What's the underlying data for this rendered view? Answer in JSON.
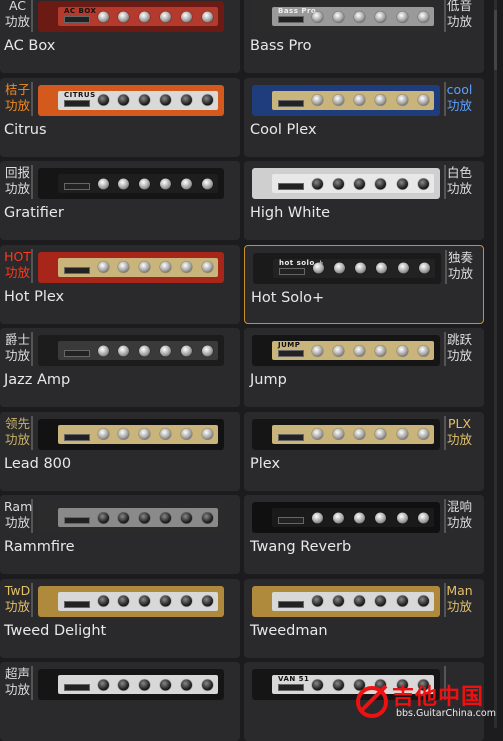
{
  "amps": [
    {
      "name": "AC Box",
      "badge": [
        "AC",
        "功放"
      ],
      "col": "left",
      "face": "#6b1a14",
      "plate": "#b33a2c",
      "knobs": "lt",
      "label": "AC BOX",
      "dark": false,
      "selected": false
    },
    {
      "name": "Bass Pro",
      "badge": [
        "低音",
        "功放"
      ],
      "col": "right",
      "face": "#2b2b2b",
      "plate": "#9a9a9a",
      "knobs": "lt",
      "label": "Bass Pro",
      "dark": false,
      "selected": false
    },
    {
      "name": "Citrus",
      "badge": [
        "桔子",
        "功放"
      ],
      "col": "left",
      "face": "#d35a1c",
      "plate": "#d9d9d9",
      "knobs": "dk",
      "label": "CITRUS",
      "dark": false,
      "selected": false,
      "badge_color": "#f08a1c"
    },
    {
      "name": "Cool Plex",
      "badge": [
        "cool",
        "功放"
      ],
      "col": "right",
      "face": "#1f3c7c",
      "plate": "#c9b57c",
      "knobs": "lt",
      "label": "",
      "dark": false,
      "selected": false,
      "badge_color": "#5aa0ff"
    },
    {
      "name": "Gratifier",
      "badge": [
        "回报",
        "功放"
      ],
      "col": "left",
      "face": "#151515",
      "plate": "#1e1e1e",
      "knobs": "lt",
      "label": "",
      "dark": true,
      "selected": false
    },
    {
      "name": "High White",
      "badge": [
        "白色",
        "功放"
      ],
      "col": "right",
      "face": "#cfcfcf",
      "plate": "#e8e8e8",
      "knobs": "dk",
      "label": "",
      "dark": false,
      "selected": false
    },
    {
      "name": "Hot Plex",
      "badge": [
        "HOT",
        "功放"
      ],
      "col": "left",
      "face": "#a8251a",
      "plate": "#c9b57c",
      "knobs": "lt",
      "label": "",
      "dark": false,
      "selected": false,
      "badge_color": "#ff3a1c"
    },
    {
      "name": "Hot Solo+",
      "badge": [
        "独奏",
        "功放"
      ],
      "col": "right",
      "face": "#1a1a1a",
      "plate": "#222",
      "knobs": "lt",
      "label": "hot solo +",
      "dark": true,
      "selected": true
    },
    {
      "name": "Jazz Amp",
      "badge": [
        "爵士",
        "功放"
      ],
      "col": "left",
      "face": "#1c1c1c",
      "plate": "#3a3a3a",
      "knobs": "lt",
      "label": "",
      "dark": true,
      "selected": false
    },
    {
      "name": "Jump",
      "badge": [
        "跳跃",
        "功放"
      ],
      "col": "right",
      "face": "#151515",
      "plate": "#c9b57c",
      "knobs": "lt",
      "label": "JUMP",
      "dark": false,
      "selected": false
    },
    {
      "name": "Lead 800",
      "badge": [
        "领先",
        "功放"
      ],
      "col": "left",
      "face": "#121212",
      "plate": "#c9b57c",
      "knobs": "lt",
      "label": "",
      "dark": false,
      "selected": false,
      "badge_color": "#c9b26a"
    },
    {
      "name": "Plex",
      "badge": [
        "PLX",
        "功放"
      ],
      "col": "right",
      "face": "#151515",
      "plate": "#c9b57c",
      "knobs": "lt",
      "label": "",
      "dark": false,
      "selected": false,
      "badge_color": "#e2c068"
    },
    {
      "name": "Rammfire",
      "badge": [
        "Ram",
        "功放"
      ],
      "col": "left",
      "face": "#2b2b2b",
      "plate": "#8a8a8a",
      "knobs": "dk",
      "label": "",
      "dark": false,
      "selected": false
    },
    {
      "name": "Twang Reverb",
      "badge": [
        "混响",
        "功放"
      ],
      "col": "right",
      "face": "#101010",
      "plate": "#1a1a1a",
      "knobs": "lt",
      "label": "",
      "dark": true,
      "selected": false
    },
    {
      "name": "Tweed Delight",
      "badge": [
        "TwD",
        "功放"
      ],
      "col": "left",
      "face": "#b08a3c",
      "plate": "#d8d8d8",
      "knobs": "dk",
      "label": "",
      "dark": false,
      "selected": false,
      "badge_color": "#e2c068"
    },
    {
      "name": "Tweedman",
      "badge": [
        "Man",
        "功放"
      ],
      "col": "right",
      "face": "#b08a3c",
      "plate": "#d8d8d8",
      "knobs": "dk",
      "label": "",
      "dark": false,
      "selected": false,
      "badge_color": "#e2c068"
    },
    {
      "name": "",
      "badge": [
        "超声",
        "功放"
      ],
      "col": "left",
      "face": "#151515",
      "plate": "#d8d8d8",
      "knobs": "dk",
      "label": "",
      "dark": false,
      "selected": false
    },
    {
      "name": "",
      "badge": [
        "",
        ""
      ],
      "col": "right",
      "face": "#151515",
      "plate": "#d8d8d8",
      "knobs": "dk",
      "label": "VAN 51",
      "dark": false,
      "selected": false
    }
  ],
  "watermark": {
    "title": "吉他中国",
    "url": "bbs.GuitarChina.com"
  }
}
